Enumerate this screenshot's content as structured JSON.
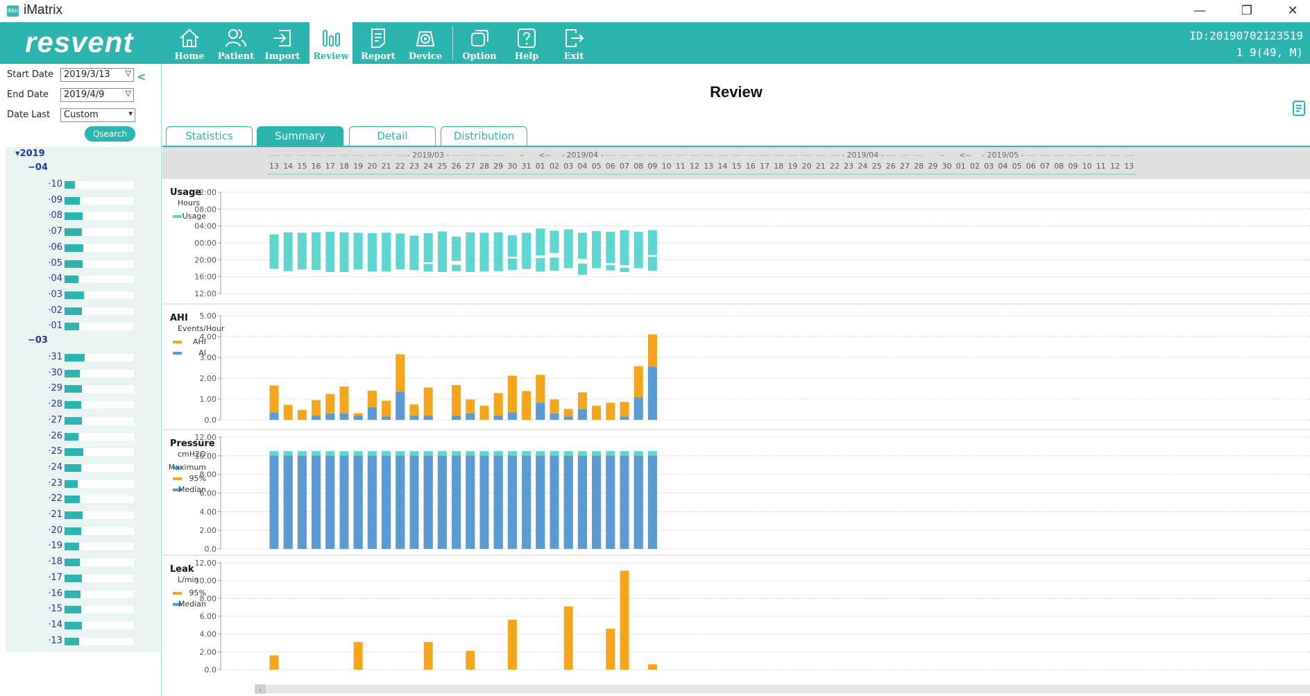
{
  "window": {
    "logo_text": "iMm",
    "title": "iMatrix",
    "controls": {
      "minimize": "—",
      "restore": "❐",
      "close": "✕"
    }
  },
  "toolbar": {
    "brand": "resvent",
    "items": [
      {
        "label": "Home",
        "icon": "home-icon"
      },
      {
        "label": "Patient",
        "icon": "patient-icon"
      },
      {
        "label": "Import",
        "icon": "import-icon"
      },
      {
        "label": "Review",
        "icon": "review-icon",
        "active": true
      },
      {
        "label": "Report",
        "icon": "report-icon"
      },
      {
        "label": "Device",
        "icon": "device-icon"
      },
      {
        "label": "Option",
        "icon": "option-icon"
      },
      {
        "label": "Help",
        "icon": "help-icon"
      },
      {
        "label": "Exit",
        "icon": "exit-icon"
      }
    ],
    "patient_id": "ID:20190702123519",
    "patient_info": "1 9(49, M)"
  },
  "filters": {
    "start_date_label": "Start Date",
    "start_date_value": "2019/3/13",
    "end_date_label": "End Date",
    "end_date_value": "2019/4/9",
    "date_last_label": "Date Last",
    "date_last_value": "Custom",
    "search_label": "Qsearch"
  },
  "tree": {
    "year": "2019",
    "months": [
      {
        "label": "04",
        "days": [
          {
            "day": "10",
            "usage": 0.15
          },
          {
            "day": "09",
            "usage": 0.22
          },
          {
            "day": "08",
            "usage": 0.26
          },
          {
            "day": "07",
            "usage": 0.25
          },
          {
            "day": "06",
            "usage": 0.27
          },
          {
            "day": "05",
            "usage": 0.26
          },
          {
            "day": "04",
            "usage": 0.2
          },
          {
            "day": "03",
            "usage": 0.28
          },
          {
            "day": "02",
            "usage": 0.25
          },
          {
            "day": "01",
            "usage": 0.21
          }
        ]
      },
      {
        "label": "03",
        "days": [
          {
            "day": "31",
            "usage": 0.29
          },
          {
            "day": "30",
            "usage": 0.22
          },
          {
            "day": "29",
            "usage": 0.25
          },
          {
            "day": "28",
            "usage": 0.24
          },
          {
            "day": "27",
            "usage": 0.25
          },
          {
            "day": "26",
            "usage": 0.2
          },
          {
            "day": "25",
            "usage": 0.27
          },
          {
            "day": "24",
            "usage": 0.24
          },
          {
            "day": "23",
            "usage": 0.19
          },
          {
            "day": "22",
            "usage": 0.22
          },
          {
            "day": "21",
            "usage": 0.26
          },
          {
            "day": "20",
            "usage": 0.24
          },
          {
            "day": "19",
            "usage": 0.21
          },
          {
            "day": "18",
            "usage": 0.22
          },
          {
            "day": "17",
            "usage": 0.25
          },
          {
            "day": "16",
            "usage": 0.23
          },
          {
            "day": "15",
            "usage": 0.24
          },
          {
            "day": "14",
            "usage": 0.25
          },
          {
            "day": "13",
            "usage": 0.21
          }
        ]
      }
    ]
  },
  "main": {
    "title": "Review",
    "tabs": [
      {
        "label": "Statistics"
      },
      {
        "label": "Summary",
        "active": true
      },
      {
        "label": "Detail"
      },
      {
        "label": "Distribution"
      }
    ],
    "timeline": {
      "days": [
        "13",
        "14",
        "15",
        "16",
        "17",
        "18",
        "19",
        "20",
        "21",
        "22",
        "23",
        "24",
        "25",
        "26",
        "27",
        "28",
        "29",
        "30",
        "31",
        "01",
        "02",
        "03",
        "04",
        "05",
        "06",
        "07",
        "08",
        "09",
        "10",
        "11",
        "12",
        "13",
        "14",
        "15",
        "16",
        "17",
        "18",
        "19",
        "20",
        "21",
        "22",
        "23",
        "24",
        "25",
        "26",
        "27",
        "28",
        "29",
        "30",
        "01",
        "02",
        "03",
        "04",
        "05",
        "06",
        "07",
        "08",
        "09",
        "10",
        "11",
        "12",
        "13"
      ],
      "month_markers": [
        {
          "text": "- 2019/03 -",
          "at": 11
        },
        {
          "text": "-->",
          "at": 18
        },
        {
          "text": "<--",
          "at": 19.3
        },
        {
          "text": "- 2019/04 -",
          "at": 22
        },
        {
          "text": "- 2019/04 -",
          "at": 42
        },
        {
          "text": "-->",
          "at": 48
        },
        {
          "text": "<--",
          "at": 49.3
        },
        {
          "text": "- 2019/05 -",
          "at": 52
        }
      ]
    }
  },
  "chart_data": [
    {
      "type": "bar",
      "title": "Usage",
      "ylabel": "Hours",
      "ytick_labels": [
        "12:00",
        "08:00",
        "04:00",
        "00:00",
        "20:00",
        "16:00",
        "12:00"
      ],
      "ylim_hours_from_noon": [
        0,
        24
      ],
      "legend": [
        "Usage"
      ],
      "colors": {
        "Usage": "#5fd6d0"
      },
      "x": [
        "03/13",
        "03/14",
        "03/15",
        "03/16",
        "03/17",
        "03/18",
        "03/19",
        "03/20",
        "03/21",
        "03/22",
        "03/23",
        "03/24",
        "03/25",
        "03/26",
        "03/27",
        "03/28",
        "03/29",
        "03/30",
        "03/31",
        "04/01",
        "04/02",
        "04/03",
        "04/04",
        "04/05",
        "04/06",
        "04/07",
        "04/08",
        "04/09"
      ],
      "sessions": [
        [
          [
            10.0,
            18.1
          ]
        ],
        [
          [
            9.5,
            18.7
          ]
        ],
        [
          [
            9.6,
            18.3
          ]
        ],
        [
          [
            9.5,
            18.4
          ],
          [
            13.9,
            14.0
          ]
        ],
        [
          [
            9.4,
            18.9
          ],
          [
            14.4,
            14.5
          ]
        ],
        [
          [
            9.5,
            18.9
          ],
          [
            15.0,
            15.1
          ]
        ],
        [
          [
            9.6,
            18.3
          ]
        ],
        [
          [
            9.7,
            18.8
          ]
        ],
        [
          [
            9.6,
            18.8
          ]
        ],
        [
          [
            9.8,
            18.3
          ]
        ],
        [
          [
            10.3,
            18.4
          ]
        ],
        [
          [
            9.7,
            16.6
          ],
          [
            17.0,
            18.8
          ]
        ],
        [
          [
            9.3,
            18.9
          ]
        ],
        [
          [
            10.5,
            16.3
          ],
          [
            17.2,
            18.7
          ]
        ],
        [
          [
            9.5,
            18.9
          ]
        ],
        [
          [
            9.6,
            18.8
          ]
        ],
        [
          [
            9.5,
            18.7
          ]
        ],
        [
          [
            10.2,
            15.3
          ],
          [
            15.7,
            18.4
          ]
        ],
        [
          [
            9.6,
            18.2
          ]
        ],
        [
          [
            8.6,
            15.0
          ],
          [
            15.6,
            18.8
          ]
        ],
        [
          [
            9.1,
            14.4
          ],
          [
            15.5,
            18.6
          ]
        ],
        [
          [
            8.8,
            18.0
          ]
        ],
        [
          [
            9.6,
            15.8
          ],
          [
            16.9,
            19.6
          ]
        ],
        [
          [
            9.2,
            18.0
          ]
        ],
        [
          [
            9.4,
            16.8
          ],
          [
            17.3,
            18.5
          ]
        ],
        [
          [
            9.0,
            17.3
          ],
          [
            17.9,
            18.9
          ]
        ],
        [
          [
            9.4,
            18.0
          ]
        ],
        [
          [
            9.0,
            14.9
          ],
          [
            15.3,
            18.6
          ]
        ]
      ]
    },
    {
      "type": "bar",
      "title": "AHI",
      "ylabel": "Events/Hour",
      "ylim": [
        0,
        5
      ],
      "yticks": [
        "5.00",
        "4.00",
        "3.00",
        "2.00",
        "1.00",
        "0.0"
      ],
      "x": [
        "03/13",
        "03/14",
        "03/15",
        "03/16",
        "03/17",
        "03/18",
        "03/19",
        "03/20",
        "03/21",
        "03/22",
        "03/23",
        "03/24",
        "03/25",
        "03/26",
        "03/27",
        "03/28",
        "03/29",
        "03/30",
        "03/31",
        "04/01",
        "04/02",
        "04/03",
        "04/04",
        "04/05",
        "04/06",
        "04/07",
        "04/08",
        "04/09"
      ],
      "colors": {
        "AHI": "#f4a71d",
        "AI": "#5b9bd5"
      },
      "series": [
        {
          "name": "AHI",
          "values": [
            1.65,
            0.72,
            0.48,
            0.95,
            1.24,
            1.6,
            0.32,
            1.4,
            0.92,
            3.15,
            0.74,
            1.55,
            0,
            1.67,
            0.98,
            0.68,
            1.28,
            2.12,
            1.38,
            2.16,
            0.98,
            0.52,
            1.32,
            0.68,
            0.82,
            0.86,
            2.58,
            4.1
          ]
        },
        {
          "name": "AI",
          "values": [
            0.35,
            0,
            0,
            0.2,
            0.3,
            0.3,
            0.2,
            0.6,
            0.15,
            1.35,
            0.2,
            0.2,
            0,
            0.2,
            0.3,
            0,
            0.2,
            0.35,
            0,
            0.82,
            0.3,
            0.15,
            0.5,
            0,
            0,
            0.15,
            1.07,
            2.55
          ]
        }
      ]
    },
    {
      "type": "bar",
      "title": "Pressure",
      "ylabel": "cmH2O",
      "ylim": [
        0,
        12
      ],
      "yticks": [
        "12.00",
        "10.00",
        "8.00",
        "6.00",
        "4.00",
        "2.00",
        "0.0"
      ],
      "x": [
        "03/13",
        "03/14",
        "03/15",
        "03/16",
        "03/17",
        "03/18",
        "03/19",
        "03/20",
        "03/21",
        "03/22",
        "03/23",
        "03/24",
        "03/25",
        "03/26",
        "03/27",
        "03/28",
        "03/29",
        "03/30",
        "03/31",
        "04/01",
        "04/02",
        "04/03",
        "04/04",
        "04/05",
        "04/06",
        "04/07",
        "04/08",
        "04/09"
      ],
      "colors": {
        "Maximum": "#5fd6d0",
        "95%": "#f4a71d",
        "Median": "#5b9bd5"
      },
      "series": [
        {
          "name": "Maximum",
          "values": [
            10.5,
            10.5,
            10.5,
            10.5,
            10.5,
            10.5,
            10.5,
            10.5,
            10.5,
            10.5,
            10.5,
            10.5,
            10.5,
            10.5,
            10.5,
            10.5,
            10.5,
            10.5,
            10.5,
            10.5,
            10.5,
            10.5,
            10.5,
            10.5,
            10.5,
            10.5,
            10.5,
            10.5
          ]
        },
        {
          "name": "95%",
          "values": [
            10.0,
            10.0,
            10.0,
            10.0,
            10.0,
            10.0,
            10.0,
            10.0,
            10.0,
            10.0,
            10.0,
            10.0,
            10.0,
            10.0,
            10.0,
            10.0,
            10.0,
            10.0,
            10.0,
            10.0,
            10.0,
            10.0,
            10.0,
            10.0,
            10.0,
            10.0,
            10.0,
            10.0
          ]
        },
        {
          "name": "Median",
          "values": [
            10.0,
            10.0,
            10.0,
            10.0,
            10.0,
            10.0,
            10.0,
            10.0,
            10.0,
            10.0,
            10.0,
            10.0,
            10.0,
            10.0,
            10.0,
            10.0,
            10.0,
            10.0,
            10.0,
            10.0,
            10.0,
            10.0,
            10.0,
            10.0,
            10.0,
            10.0,
            10.0,
            10.0
          ]
        }
      ]
    },
    {
      "type": "bar",
      "title": "Leak",
      "ylabel": "L/min",
      "ylim": [
        0,
        12
      ],
      "yticks": [
        "12.00",
        "10.00",
        "8.00",
        "6.00",
        "4.00",
        "2.00",
        "0.0"
      ],
      "x": [
        "03/13",
        "03/14",
        "03/15",
        "03/16",
        "03/17",
        "03/18",
        "03/19",
        "03/20",
        "03/21",
        "03/22",
        "03/23",
        "03/24",
        "03/25",
        "03/26",
        "03/27",
        "03/28",
        "03/29",
        "03/30",
        "03/31",
        "04/01",
        "04/02",
        "04/03",
        "04/04",
        "04/05",
        "04/06",
        "04/07",
        "04/08",
        "04/09"
      ],
      "colors": {
        "95%": "#f4a71d",
        "Median": "#5b9bd5"
      },
      "series": [
        {
          "name": "95%",
          "values": [
            1.6,
            0,
            0,
            0,
            0,
            0,
            3.1,
            0,
            0,
            0,
            0,
            3.1,
            0,
            0,
            2.1,
            0,
            0,
            5.6,
            0,
            0,
            0,
            7.1,
            0,
            0,
            4.6,
            11.1,
            0,
            0.6
          ]
        },
        {
          "name": "Median",
          "values": [
            0,
            0,
            0,
            0,
            0,
            0,
            0,
            0,
            0,
            0,
            0,
            0,
            0,
            0,
            0,
            0,
            0,
            0,
            0,
            0,
            0,
            0,
            0,
            0,
            0,
            0,
            0,
            0
          ]
        }
      ]
    }
  ]
}
